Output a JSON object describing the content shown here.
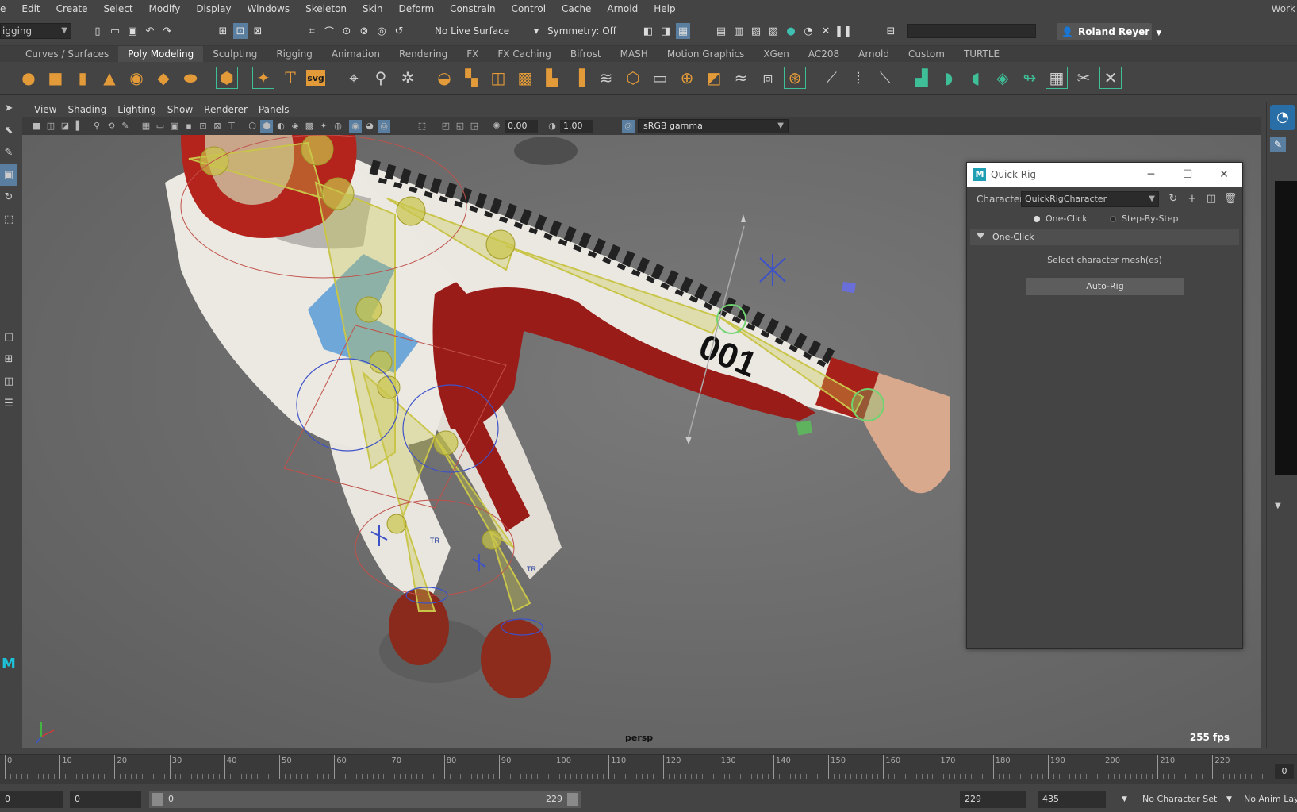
{
  "menubar": {
    "items": [
      "e",
      "Edit",
      "Create",
      "Select",
      "Modify",
      "Display",
      "Windows",
      "Skeleton",
      "Skin",
      "Deform",
      "Constrain",
      "Control",
      "Cache",
      "Arnold",
      "Help"
    ],
    "workspace": "Work"
  },
  "statusline": {
    "mode": "igging",
    "live_surface": "No Live Surface",
    "symmetry": "Symmetry: Off",
    "user": "Roland Reyer"
  },
  "shelf": {
    "tabs": [
      "Curves / Surfaces",
      "Poly Modeling",
      "Sculpting",
      "Rigging",
      "Animation",
      "Rendering",
      "FX",
      "FX Caching",
      "Bifrost",
      "MASH",
      "Motion Graphics",
      "XGen",
      "AC208",
      "Arnold",
      "Custom",
      "TURTLE"
    ],
    "active_tab": "Poly Modeling",
    "text_icon": "T",
    "svg_icon": "svg"
  },
  "viewport": {
    "menus": [
      "View",
      "Shading",
      "Lighting",
      "Show",
      "Renderer",
      "Panels"
    ],
    "exposure": "0.00",
    "gamma": "1.00",
    "color_space": "sRGB gamma",
    "camera": "persp",
    "fps": "255 fps",
    "decal_number": "001",
    "joint_marker": "TR"
  },
  "quick_rig": {
    "title": "Quick Rig",
    "character_label": "Character:",
    "character_value": "QuickRigCharacter",
    "mode_one_click": "One-Click",
    "mode_step": "Step-By-Step",
    "section": "One-Click",
    "hint": "Select character mesh(es)",
    "auto_rig": "Auto-Rig"
  },
  "timeline": {
    "ticks": [
      "0",
      "10",
      "20",
      "30",
      "40",
      "50",
      "60",
      "70",
      "80",
      "90",
      "100",
      "110",
      "120",
      "130",
      "140",
      "150",
      "160",
      "170",
      "180",
      "190",
      "200",
      "210",
      "220"
    ],
    "current_frame": "0"
  },
  "range": {
    "start": "0",
    "anim_start": "0",
    "range_start": "0",
    "range_end": "229",
    "anim_end": "229",
    "end": "435",
    "character_set": "No Character Set",
    "anim_layer": "No Anim Laye"
  },
  "colors": {
    "accent": "#e39b3a",
    "rig_yellow": "#c9c54a",
    "suit_red": "#8e1b16",
    "ui_bg": "#444444"
  }
}
